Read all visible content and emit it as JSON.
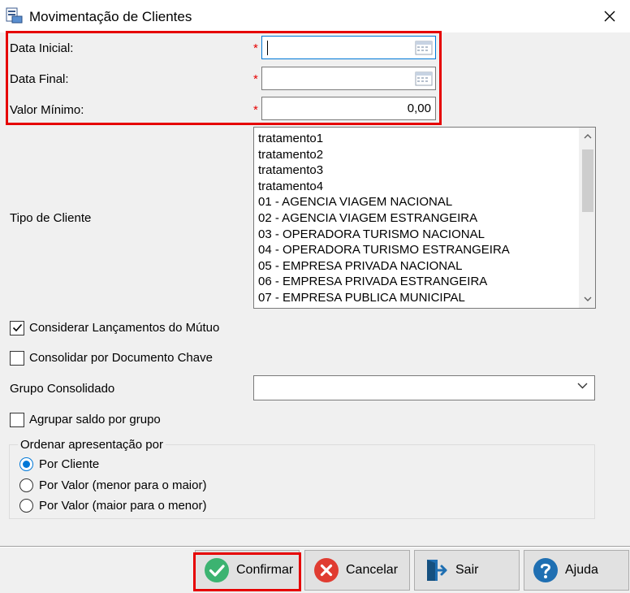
{
  "window": {
    "title": "Movimentação de Clientes",
    "app_icon": "report-icon",
    "close_icon": "close-icon"
  },
  "fields": {
    "data_inicial": {
      "label": "Data Inicial:",
      "value": "",
      "required_mark": "*",
      "icon": "calendar-icon"
    },
    "data_final": {
      "label": "Data Final:",
      "value": "",
      "required_mark": "*",
      "icon": "calendar-icon"
    },
    "valor_minimo": {
      "label": "Valor Mínimo:",
      "value": "0,00",
      "required_mark": "*"
    }
  },
  "tipo_cliente": {
    "label": "Tipo de Cliente",
    "items": [
      "tratamento1",
      "tratamento2",
      "tratamento3",
      "tratamento4",
      "01 - AGENCIA VIAGEM NACIONAL",
      "02 - AGENCIA VIAGEM ESTRANGEIRA",
      "03 - OPERADORA TURISMO NACIONAL",
      "04 - OPERADORA TURISMO ESTRANGEIRA",
      "05 - EMPRESA PRIVADA NACIONAL",
      "06 - EMPRESA PRIVADA ESTRANGEIRA",
      "07 - EMPRESA PUBLICA MUNICIPAL"
    ]
  },
  "checkboxes": {
    "considerar": {
      "label": "Considerar Lançamentos do Mútuo",
      "checked": true
    },
    "consolidar": {
      "label": "Consolidar por Documento Chave",
      "checked": false
    },
    "agrupar": {
      "label": "Agrupar saldo por grupo",
      "checked": false
    }
  },
  "grupo_consolidado": {
    "label": "Grupo Consolidado",
    "value": ""
  },
  "ordenar": {
    "title": "Ordenar apresentação por",
    "options": [
      {
        "label": "Por Cliente",
        "checked": true
      },
      {
        "label": "Por Valor (menor para o maior)",
        "checked": false
      },
      {
        "label": "Por Valor (maior para o menor)",
        "checked": false
      }
    ]
  },
  "buttons": {
    "confirmar": {
      "label": "Confirmar",
      "icon": "check-circle-icon",
      "color": "#3cb371"
    },
    "cancelar": {
      "label": "Cancelar",
      "icon": "x-circle-icon",
      "color": "#e03c31"
    },
    "sair": {
      "label": "Sair",
      "icon": "exit-door-icon",
      "color": "#1f6fb2"
    },
    "ajuda": {
      "label": "Ajuda",
      "icon": "help-circle-icon",
      "color": "#1f6fb2"
    }
  },
  "colors": {
    "required": "#e60000",
    "focus": "#0078d7",
    "window_bg": "#f0f0f0"
  }
}
